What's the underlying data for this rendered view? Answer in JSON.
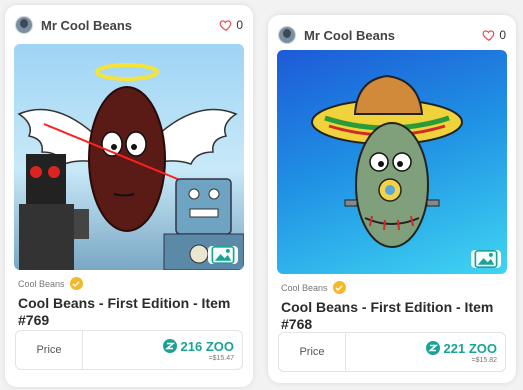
{
  "cards": [
    {
      "owner": "Mr Cool Beans",
      "likes": "0",
      "collection": "Cool Beans",
      "title": "Cool Beans - First Edition - Item #769",
      "price_label": "Price",
      "price_zoo": "216 ZOO",
      "price_usd": "=$15.47"
    },
    {
      "owner": "Mr Cool Beans",
      "likes": "0",
      "collection": "Cool Beans",
      "title": "Cool Beans - First Edition - Item #768",
      "price_label": "Price",
      "price_zoo": "221 ZOO",
      "price_usd": "=$15.82"
    }
  ],
  "colors": {
    "accent": "#1aa394",
    "heart": "#e0474c",
    "verified": "#f4b829"
  },
  "icons": [
    "heart-icon",
    "verified-check-icon",
    "image-icon",
    "zoo-token-icon"
  ]
}
